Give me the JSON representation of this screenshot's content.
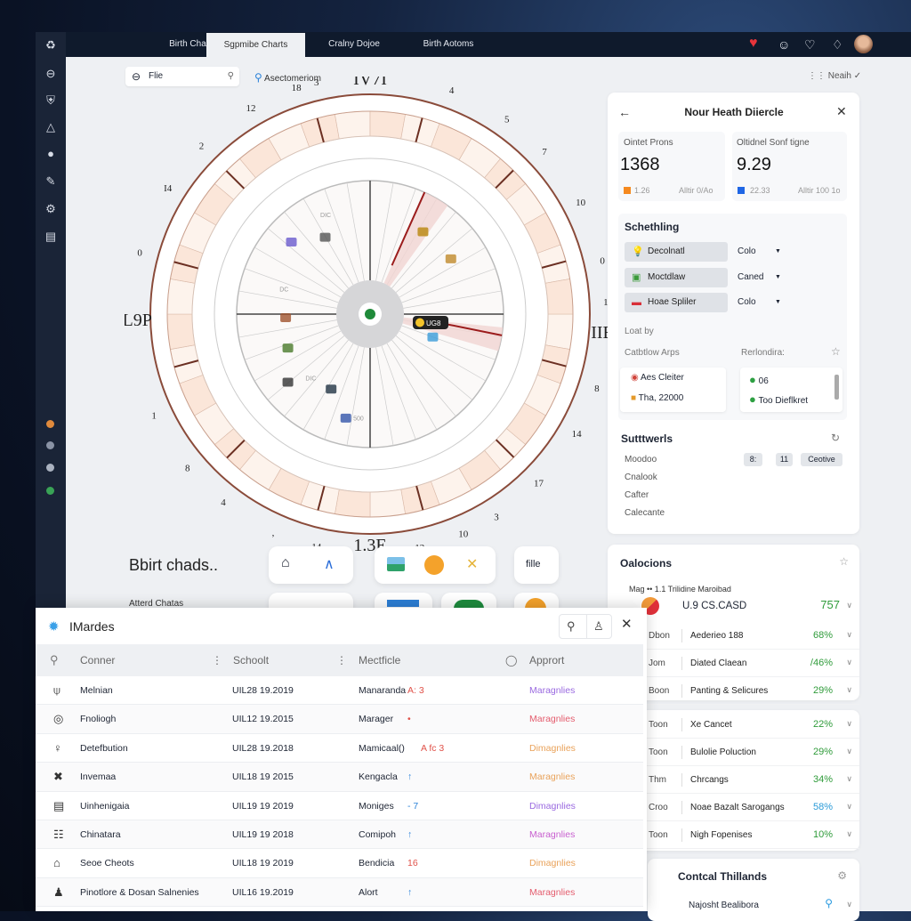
{
  "tabs": [
    {
      "label": "Birth Chamts"
    },
    {
      "label": "Sgpmibe Charts",
      "active": true
    },
    {
      "label": "Cralny Dojoe"
    },
    {
      "label": "Birth Aotoms"
    }
  ],
  "topbar_icons": [
    "heart-icon",
    "gauge-icon",
    "heart-outline-icon",
    "bell-icon",
    "avatar"
  ],
  "filter": {
    "value": "Flie",
    "search_label": "Asectomeriom",
    "right_label": "Neaih"
  },
  "wheel": {
    "labels": [
      "IV7I",
      "3",
      "4",
      "5",
      "7",
      "10",
      "0",
      "18",
      "IIE",
      "8",
      "14",
      "17",
      "3",
      "10",
      "12",
      "1.3E",
      "14",
      ",",
      "4",
      "8",
      "1",
      "L9P",
      "0",
      "I4",
      "2",
      "12",
      "18"
    ],
    "tooltip": "UG8",
    "inner_texts": [
      "DIC",
      "DC",
      "DIC",
      "500"
    ]
  },
  "bottom": {
    "title": "Bbirt chads..",
    "subtitle": "Atterd Chatas",
    "file_label": "fille"
  },
  "panel": {
    "title": "Nour Heath Diiercle",
    "stats": [
      {
        "label": "Ointet Prons",
        "value": "1368",
        "sub": "1.26",
        "note": "Alltir 0/Ao",
        "color": "#f5891f"
      },
      {
        "label": "Oltidnel Sonf tigne",
        "value": "9.29",
        "sub": "22.33",
        "note": "Alltir 100 1o",
        "color": "#1f66e5"
      }
    ],
    "section_title": "Schethling",
    "settings": [
      {
        "label": "Decolnatl",
        "value": "Colo",
        "icon": "lightbulb-icon"
      },
      {
        "label": "Moctdlaw",
        "value": "Caned",
        "icon": "image-icon"
      },
      {
        "label": "Hoae Spliler",
        "value": "Colo",
        "icon": "lips-icon"
      }
    ],
    "loat_by": "Loat by",
    "left_title": "Catbtlow Arps",
    "right_title": "Rerlondira:",
    "left_items": [
      "Aes Cleiter",
      "Tha, 22000"
    ],
    "right_items": [
      "06",
      "Too Dieflkret"
    ],
    "soft_title": "Sutttwerls",
    "soft_rows": [
      "Moodoo",
      "Cnalook",
      "Cafter",
      "Calecante"
    ],
    "soft_buttons": [
      "8:",
      "11",
      "Ceotive"
    ]
  },
  "calc": {
    "title": "Oalocions",
    "header_small": "Mag  •• 1.1  Trilidine Maroibad",
    "top": {
      "name": "U.9 CS.CASD",
      "value": "757"
    },
    "group1": [
      {
        "a": "Dbon",
        "n": "Aederieo 188",
        "p": "68%"
      },
      {
        "a": "Jom",
        "n": "Diated Claean",
        "p": "/46%"
      },
      {
        "a": "Boon",
        "n": "Panting & Selicures",
        "p": "29%"
      }
    ],
    "group2": [
      {
        "a": "Toon",
        "n": "Xe Cancet",
        "p": "22%"
      },
      {
        "a": "Toon",
        "n": "Bulolie Poluction",
        "p": "29%"
      },
      {
        "a": "Thm",
        "n": "Chrcangs",
        "p": "34%"
      },
      {
        "a": "Croo",
        "n": "Noae Bazalt Sarogangs",
        "p": "58%",
        "color": "#2b9bd8"
      },
      {
        "a": "Toon",
        "n": "Nigh Fopenises",
        "p": "10%"
      }
    ],
    "contcal_title": "Contcal Thillands",
    "contcal_item": "Najosht Bealibora"
  },
  "modal": {
    "title": "IMardes",
    "columns": [
      "Conner",
      "Schoolt",
      "Mectficle",
      "Apprort"
    ],
    "rows": [
      {
        "icon": "⍦",
        "name": "Melnian",
        "date": "UIL28 19.2019",
        "m": "Manaranda",
        "tag": "A: 3",
        "tagc": "#e0524a",
        "ap": "Maragnlies",
        "apc": "#9a6ae0"
      },
      {
        "icon": "◎",
        "name": "Fnoliogh",
        "date": "UIL12 19.2015",
        "m": "Marager",
        "tag": "•",
        "tagc": "#e0524a",
        "ap": "Maragnlies",
        "apc": "#e45d6e"
      },
      {
        "icon": "♀",
        "name": "Detefbution",
        "date": "UIL28 19.2018",
        "m": "Mamicaal()",
        "tag": "A fc 3",
        "tagc": "#e0524a",
        "ap": "Dimagnlies",
        "apc": "#e9a25a"
      },
      {
        "icon": "✖",
        "name": "Invemaa",
        "date": "UIL18 19 2015",
        "m": "Kengacla",
        "tag": "↑",
        "tagc": "#2d83d9",
        "ap": "Maragnlies",
        "apc": "#e9a25a"
      },
      {
        "icon": "▤",
        "name": "Uinhenigaia",
        "date": "UIL19 19 2019",
        "m": "Moniges",
        "tag": "- 7",
        "tagc": "#2d83d9",
        "ap": "Dimagnlies",
        "apc": "#9a6ae0"
      },
      {
        "icon": "☷",
        "name": "Chinatara",
        "date": "UIL19 19 2018",
        "m": "Comipoh",
        "tag": "↑",
        "tagc": "#2d83d9",
        "ap": "Maragnlies",
        "apc": "#c85fcf"
      },
      {
        "icon": "⌂",
        "name": "Seoe Cheots",
        "date": "UIL18 19 2019",
        "m": "Bendicia",
        "tag": "16",
        "tagc": "#e0524a",
        "ap": "Dimagnlies",
        "apc": "#e9a25a"
      },
      {
        "icon": "♟",
        "name": "Pinotlore & Dosan Salnenies",
        "date": "UIL16 19.2019",
        "m": "Alort",
        "tag": "↑",
        "tagc": "#2d83d9",
        "ap": "Maragnlies",
        "apc": "#e45d6e"
      }
    ]
  }
}
